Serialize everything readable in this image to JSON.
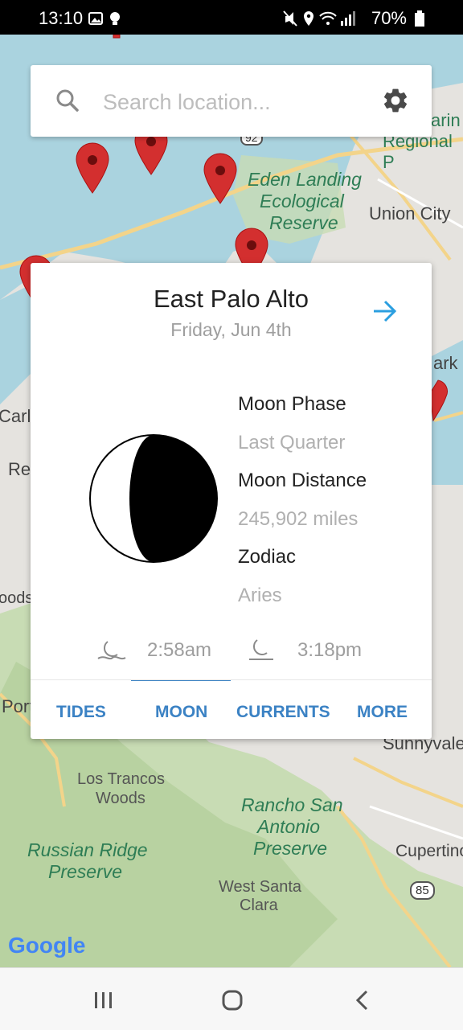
{
  "status_bar": {
    "time": "13:10",
    "battery": "70%"
  },
  "search": {
    "placeholder": "Search location..."
  },
  "map_labels": {
    "eden_landing": "Eden Landing",
    "ecological": "Ecological",
    "reserve": "Reserve",
    "union_city": "Union City",
    "arin": "arin",
    "regional": "Regional P",
    "ark": "ark",
    "carl": "Carlo",
    "re": "Re",
    "oods": "oods",
    "port": "Port",
    "sunnyvale": "Sunnyvale",
    "los_trancos_1": "Los Trancos",
    "los_trancos_2": "Woods",
    "rancho_1": "Rancho San",
    "rancho_2": "Antonio",
    "rancho_3": "Preserve",
    "russian_1": "Russian Ridge",
    "russian_2": "Preserve",
    "cupertino": "Cupertino",
    "west_santa_1": "West Santa",
    "west_santa_2": "Clara",
    "hw85": "85",
    "hw92": "92"
  },
  "google_logo": "Google",
  "panel": {
    "title": "East Palo Alto",
    "date": "Friday, Jun 4th",
    "moon_phase_label": "Moon Phase",
    "moon_phase_value": "Last Quarter",
    "moon_distance_label": "Moon Distance",
    "moon_distance_value": "245,902 miles",
    "zodiac_label": "Zodiac",
    "zodiac_value": "Aries",
    "moonrise_time": "2:58am",
    "moonset_time": "3:18pm"
  },
  "tabs": [
    {
      "label": "TIDES"
    },
    {
      "label": "MOON"
    },
    {
      "label": "CURRENTS"
    },
    {
      "label": "MORE"
    }
  ],
  "colors": {
    "accent": "#3b82c4",
    "pin": "#d32f2f",
    "water": "#aad3df",
    "land": "#e5e3df",
    "park": "#c8dcb4"
  }
}
